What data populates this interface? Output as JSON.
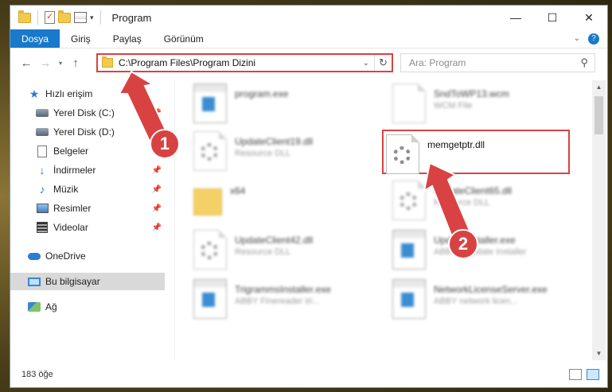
{
  "window": {
    "title": "Program"
  },
  "ribbon": {
    "tabs": [
      "Dosya",
      "Giriş",
      "Paylaş",
      "Görünüm"
    ]
  },
  "address": {
    "path": "C:\\Program Files\\Program Dizini",
    "search_placeholder": "Ara: Program"
  },
  "sidebar": {
    "items": [
      {
        "label": "Hızlı erişim",
        "icon": "star-icon"
      },
      {
        "label": "Yerel Disk (C:)",
        "icon": "disk-icon"
      },
      {
        "label": "Yerel Disk (D:)",
        "icon": "disk-icon"
      },
      {
        "label": "Belgeler",
        "icon": "document-icon"
      },
      {
        "label": "İndirmeler",
        "icon": "download-icon"
      },
      {
        "label": "Müzik",
        "icon": "music-icon"
      },
      {
        "label": "Resimler",
        "icon": "pictures-icon"
      },
      {
        "label": "Videolar",
        "icon": "video-icon"
      },
      {
        "label": "OneDrive",
        "icon": "cloud-icon"
      },
      {
        "label": "Bu bilgisayar",
        "icon": "computer-icon"
      },
      {
        "label": "Ağ",
        "icon": "network-icon"
      }
    ]
  },
  "files": [
    {
      "name": "program.exe",
      "desc": ""
    },
    {
      "name": "SndToWP13.wcm",
      "desc": "WCM File"
    },
    {
      "name": "UpdateClient19.dll",
      "desc": "Resource DLL"
    },
    {
      "name": "x64",
      "desc": ""
    },
    {
      "name": "UpdateClient65.dll",
      "desc": "Resource DLL"
    },
    {
      "name": "UpdateClient42.dll",
      "desc": "Resource DLL"
    },
    {
      "name": "UpdateInstaller.exe",
      "desc": "ABBYY Update Installer"
    },
    {
      "name": "TrigrammsInstaller.exe",
      "desc": "ABBY Finereader tri..."
    },
    {
      "name": "NetworkLicenseServer.exe",
      "desc": "ABBY network licen..."
    }
  ],
  "highlighted_file": {
    "name": "memgetptr.dll"
  },
  "status": {
    "count": "183 öğe"
  },
  "annotations": {
    "step1": "1",
    "step2": "2"
  },
  "colors": {
    "accent": "#1979ca",
    "highlight": "#d94242"
  }
}
